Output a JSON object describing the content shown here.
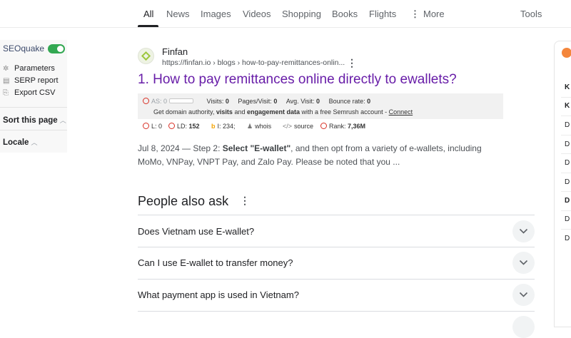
{
  "tabs": [
    {
      "label": "All",
      "active": true
    },
    {
      "label": "News"
    },
    {
      "label": "Images"
    },
    {
      "label": "Videos"
    },
    {
      "label": "Shopping"
    },
    {
      "label": "Books"
    },
    {
      "label": "Flights"
    },
    {
      "label": "More"
    },
    {
      "label": "Tools"
    }
  ],
  "seoquake": {
    "title": "SEOquake",
    "enabled": true,
    "links": [
      {
        "label": "Parameters",
        "icon": "gear-icon"
      },
      {
        "label": "SERP report",
        "icon": "report-icon"
      },
      {
        "label": "Export CSV",
        "icon": "export-icon"
      }
    ],
    "sort_label": "Sort this page",
    "locale_label": "Locale"
  },
  "result": {
    "site_name": "Finfan",
    "url": "https://finfan.io › blogs › how-to-pay-remittances-onlin...",
    "title": "1. How to pay remittances online directly to ewallets?",
    "seo": {
      "as_label": "AS: 0",
      "visits_label": "Visits:",
      "visits_value": "0",
      "ppv_label": "Pages/Visit:",
      "ppv_value": "0",
      "avg_label": "Avg. Visit:",
      "avg_value": "0",
      "bounce_label": "Bounce rate:",
      "bounce_value": "0",
      "promo_prefix": "Get domain authority,",
      "promo_visits": "visits",
      "promo_and": "and",
      "promo_engagement": "engagement data",
      "promo_suffix": "with a free Semrush account -",
      "connect": "Connect",
      "l_label": "L: 0",
      "ld_label": "LD:",
      "ld_value": "152",
      "i_label": "I: 234;",
      "whois": "whois",
      "source": "source",
      "rank_label": "Rank:",
      "rank_value": "7,36M"
    },
    "snippet_date": "Jul 8, 2024 — Step 2:",
    "snippet_bold": "Select \"E-wallet\"",
    "snippet_rest": ", and then opt from a variety of e-wallets, including",
    "snippet_line2": "MoMo, VNPay, VNPT Pay, and Zalo Pay. Please be noted that you ..."
  },
  "paa": {
    "title": "People also ask",
    "questions": [
      "Does Vietnam use E-wallet?",
      "Can I use E-wallet to transfer money?",
      "What payment app is used in Vietnam?"
    ]
  },
  "right_panel": {
    "items": [
      "K",
      "K",
      "D",
      "D",
      "D",
      "D",
      "D",
      "D",
      "D"
    ]
  },
  "colors": {
    "visited_link": "#681da8",
    "toggle_on": "#33a852",
    "seo_circle": "#d93025"
  }
}
